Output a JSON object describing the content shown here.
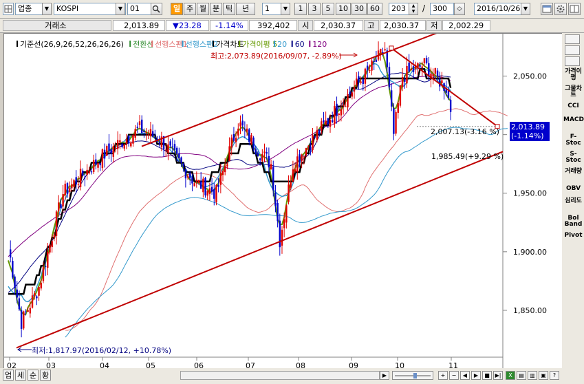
{
  "toolbar": {
    "category": "업종",
    "index": "KOSPI",
    "period_value": "01",
    "period_tabs": [
      "일",
      "주",
      "월",
      "분",
      "틱",
      "년"
    ],
    "interval_value": "1",
    "interval_buttons": [
      "1",
      "3",
      "5",
      "10",
      "30",
      "60"
    ],
    "count_value": "203",
    "total_value": "300",
    "date_value": "2016/10/26",
    "slash": "/"
  },
  "quote": {
    "exchange": "거래소",
    "price": "2,013.89",
    "change": "▼23.28",
    "change_pct": "-1.14%",
    "volume": "392,402",
    "open_label": "시",
    "open": "2,030.37",
    "high_label": "고",
    "high": "2,030.37",
    "low_label": "저",
    "low": "2,002.29"
  },
  "legend": [
    {
      "label": "기준선(26,9,26,52,26,26,26)",
      "color": "#000000"
    },
    {
      "label": "전환선",
      "color": "#2e8b2e"
    },
    {
      "label": "선행스팬1",
      "color": "#e07070"
    },
    {
      "label": "선행스팬2",
      "color": "#3399cc"
    },
    {
      "label": "가격차트",
      "color": "#000000"
    },
    {
      "label": "가격이평 5",
      "color": "#669900"
    },
    {
      "label": "20",
      "color": "#3399cc"
    },
    {
      "label": "60",
      "color": "#000080"
    },
    {
      "label": "120",
      "color": "#800080"
    }
  ],
  "annotations": {
    "high": "최고:2,073.89(2016/09/07, -2.89%)",
    "low": "최저:1,817.97(2016/02/12, +10.78%)",
    "line1": "2,007.13(-3.16 %)",
    "line2": "1,985.49(+9.29 %)",
    "current_price": "2,013.89",
    "current_pct": "(-1.14%)"
  },
  "chart_data": {
    "type": "candlestick",
    "x_labels": [
      "02",
      "03",
      "04",
      "05",
      "06",
      "07",
      "08",
      "09",
      "10",
      "11"
    ],
    "y_ticks": [
      "2,050.00",
      "2,000.00",
      "1,950.00",
      "1,900.00",
      "1,850.00"
    ],
    "y_range": [
      1810,
      2085
    ],
    "trendline_upper": {
      "from": "2016-02",
      "to": "2016-11",
      "y_from": 1950,
      "y_to": 2085
    },
    "trendline_lower": {
      "from": "2016-02",
      "to": "2016-11",
      "y_from": 1817.97,
      "y_to": 1985.49
    },
    "trendline_down": {
      "from": "2016-09-07",
      "to": "2016-10-26",
      "y_from": 2073.89,
      "y_to": 2007.13
    },
    "colors": {
      "up": "#e00000",
      "down": "#0000cc",
      "trend": "#c00000"
    }
  },
  "right_toolbar": [
    "가격이평",
    "그물차트",
    "CCI",
    "MACD",
    "F-Stoc",
    "S-Stoc",
    "거래량",
    "OBV",
    "심리도",
    "Bol Band",
    "Pivot"
  ],
  "bottom_tabs": [
    "업",
    "세",
    "순",
    "황"
  ]
}
